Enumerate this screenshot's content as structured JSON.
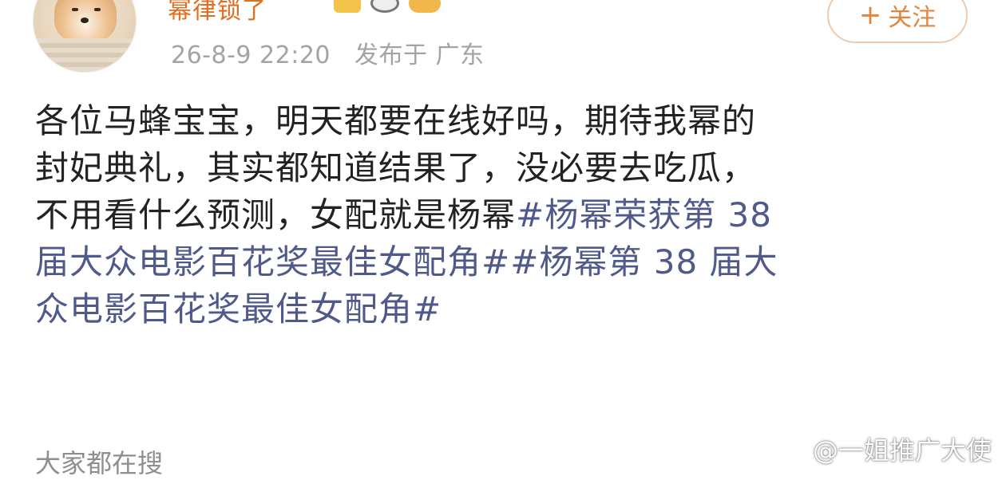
{
  "post": {
    "username": "幂律锁了",
    "time": "26-8-9 22:20",
    "location": "发布于 广东",
    "follow_plus": "+",
    "follow_label": "关注",
    "lines": [
      [
        {
          "t": "各位马蜂宝宝，明天都要在线好吗，期待我幂的"
        }
      ],
      [
        {
          "t": "封妃典礼，其实都知道结果了，没必要去吃瓜，"
        }
      ],
      [
        {
          "t": "不用看什么预测，女配就是杨幂"
        },
        {
          "t": "#杨幂荣获第 38",
          "tag": true
        }
      ],
      [
        {
          "t": "届大众电影百花奖最佳女配角##杨幂第 38 届大",
          "tag": true
        }
      ],
      [
        {
          "t": "众电影百花奖最佳女配角#",
          "tag": true
        }
      ]
    ]
  },
  "footer": {
    "trending_label": "大家都在搜",
    "watermark": "@一姐推广大使"
  },
  "colors": {
    "username": "#e36d1f",
    "hashtag": "#505a8a",
    "meta": "#a3a3a3",
    "follow_border": "#f0c9ab"
  }
}
